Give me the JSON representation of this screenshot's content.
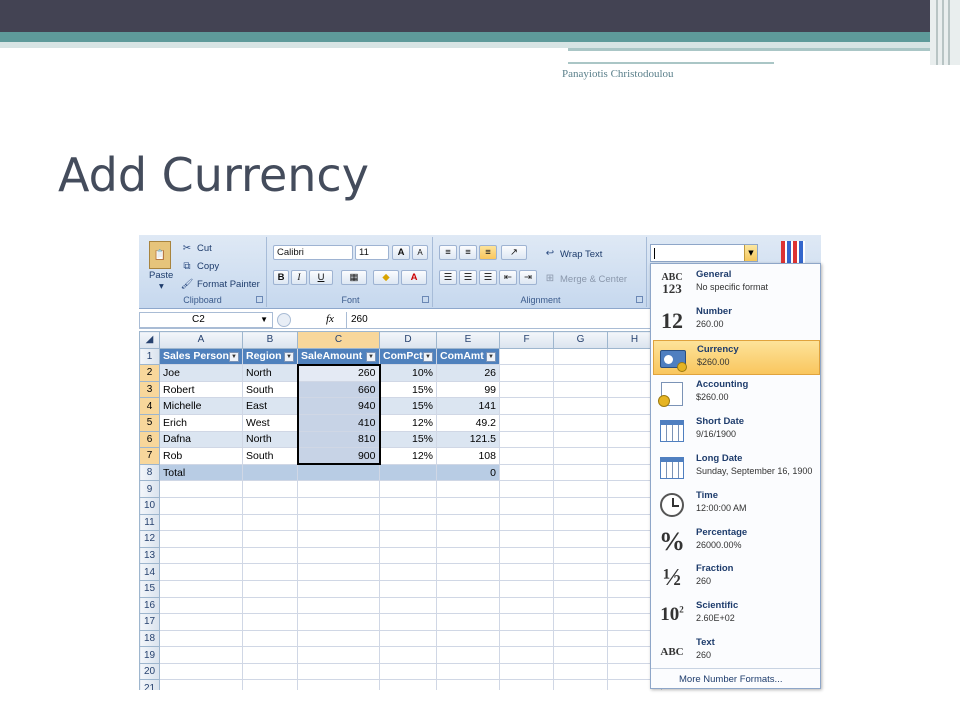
{
  "slide": {
    "author": "Panayiotis Christodoulou",
    "title": "Add Currency"
  },
  "ribbon": {
    "clipboard": {
      "paste": "Paste",
      "cut": "Cut",
      "copy": "Copy",
      "format_painter": "Format Painter",
      "label": "Clipboard"
    },
    "font": {
      "name": "Calibri",
      "size": "11",
      "bold": "B",
      "italic": "I",
      "underline": "U",
      "label": "Font"
    },
    "alignment": {
      "wrap_text": "Wrap Text",
      "merge_center": "Merge & Center",
      "label": "Alignment"
    }
  },
  "formula_bar": {
    "name_box": "C2",
    "fx": "fx",
    "value": "260"
  },
  "sheet": {
    "columns": [
      "A",
      "B",
      "C",
      "D",
      "E",
      "F",
      "G",
      "H"
    ],
    "headers": [
      "Sales Person",
      "Region",
      "SaleAmount",
      "ComPct",
      "ComAmt"
    ],
    "rows": [
      [
        "Joe",
        "North",
        "260",
        "10%",
        "26"
      ],
      [
        "Robert",
        "South",
        "660",
        "15%",
        "99"
      ],
      [
        "Michelle",
        "East",
        "940",
        "15%",
        "141"
      ],
      [
        "Erich",
        "West",
        "410",
        "12%",
        "49.2"
      ],
      [
        "Dafna",
        "North",
        "810",
        "15%",
        "121.5"
      ],
      [
        "Rob",
        "South",
        "900",
        "12%",
        "108"
      ]
    ],
    "total_row": [
      "Total",
      "",
      "",
      "",
      "0"
    ],
    "row_numbers": [
      "1",
      "2",
      "3",
      "4",
      "5",
      "6",
      "7",
      "8",
      "9",
      "10",
      "11",
      "12",
      "13",
      "14",
      "15",
      "16",
      "17",
      "18",
      "19",
      "20",
      "21"
    ]
  },
  "number_formats": {
    "items": [
      {
        "name": "General",
        "example": "No specific format",
        "icon": "ABC\n123"
      },
      {
        "name": "Number",
        "example": "260.00",
        "icon": "12"
      },
      {
        "name": "Currency",
        "example": "$260.00",
        "icon": "currency"
      },
      {
        "name": "Accounting",
        "example": "$260.00",
        "icon": "accounting"
      },
      {
        "name": "Short Date",
        "example": "9/16/1900",
        "icon": "calendar"
      },
      {
        "name": "Long Date",
        "example": "Sunday, September 16, 1900",
        "icon": "calendar"
      },
      {
        "name": "Time",
        "example": "12:00:00 AM",
        "icon": "clock"
      },
      {
        "name": "Percentage",
        "example": "26000.00%",
        "icon": "%"
      },
      {
        "name": "Fraction",
        "example": "260",
        "icon": "½"
      },
      {
        "name": "Scientific",
        "example": "2.60E+02",
        "icon": "10²"
      },
      {
        "name": "Text",
        "example": "260",
        "icon": "ABC"
      }
    ],
    "more": "More Number Formats..."
  }
}
